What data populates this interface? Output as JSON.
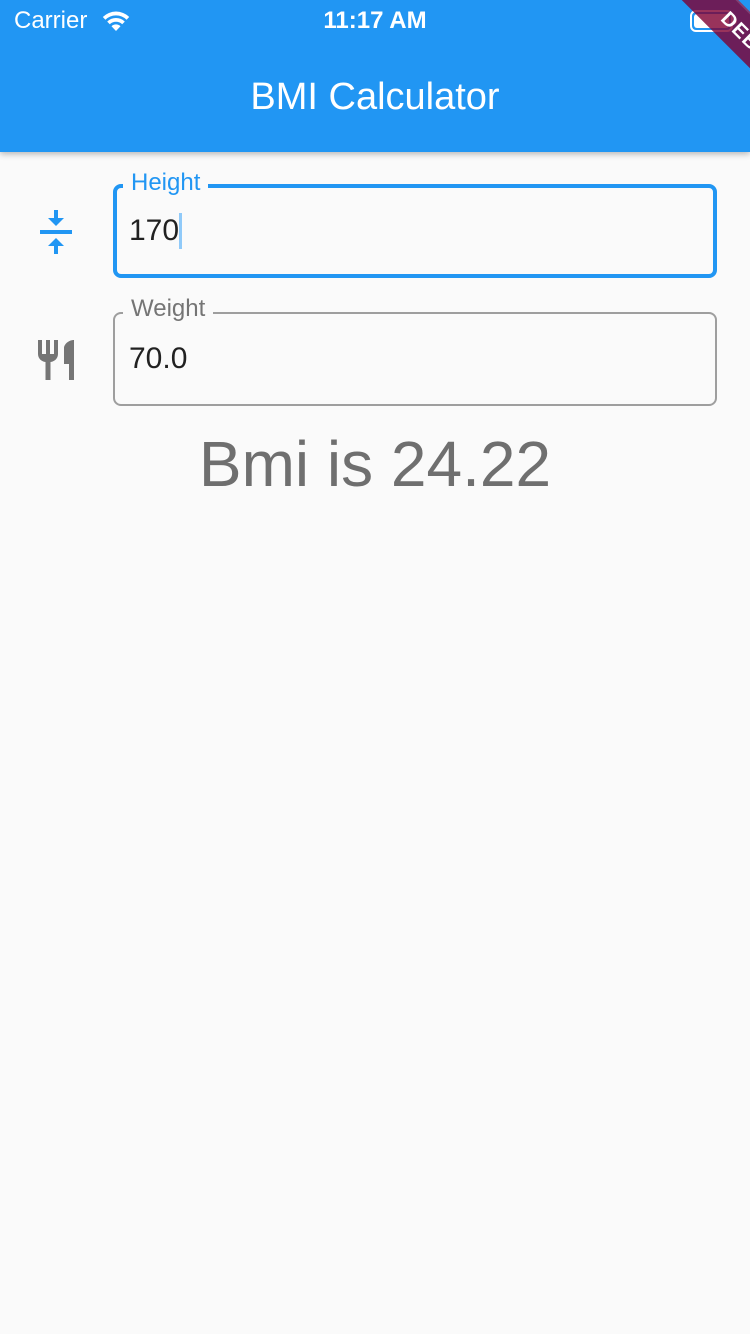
{
  "status_bar": {
    "carrier": "Carrier",
    "time": "11:17 AM",
    "wifi_icon": "wifi-icon",
    "battery_icon": "battery-icon"
  },
  "app_bar": {
    "title": "BMI Calculator",
    "background": "#2196f3"
  },
  "debug_banner": {
    "label": "DEBUG",
    "color": "#800032"
  },
  "form": {
    "height": {
      "icon": "vertical-align-center-icon",
      "label": "Height",
      "value": "170",
      "focused": true
    },
    "weight": {
      "icon": "restaurant-icon",
      "label": "Weight",
      "value": "70.0",
      "focused": false
    }
  },
  "result": {
    "text": "Bmi is 24.22"
  },
  "colors": {
    "accent": "#2196f3",
    "background": "#fafafa",
    "text_secondary": "#757575"
  }
}
